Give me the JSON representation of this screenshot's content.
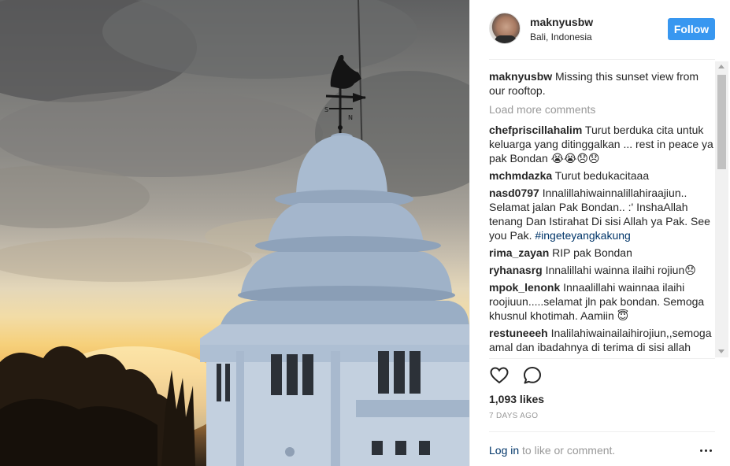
{
  "post": {
    "username": "maknyusbw",
    "location": "Bali, Indonesia",
    "follow_label": "Follow",
    "caption": "Missing this sunset view from our rooftop.",
    "load_more": "Load more comments"
  },
  "comments": [
    {
      "user": "chefpriscillahalim",
      "text": "Turut berduka cita untuk keluarga yang ditinggalkan ... rest in peace ya pak Bondan 😭😭😞😞"
    },
    {
      "user": "mchmdazka",
      "text": "Turut bedukacitaaa"
    },
    {
      "user": "nasd0797",
      "text": "Innalillahiwainnalillahiraajiun.. Selamat jalan Pak Bondan.. :' InshaAllah tenang Dan Istirahat Di sisi Allah ya Pak. See you Pak.",
      "hashtag": "#ingeteyangkakung"
    },
    {
      "user": "rima_zayan",
      "text": "RIP pak Bondan"
    },
    {
      "user": "ryhanasrg",
      "text": "Innalillahi wainna ilaihi rojiun😞"
    },
    {
      "user": "mpok_lenonk",
      "text": "Innaalillahi wainnaa ilaihi roojiuun.....selamat jln pak bondan. Semoga khusnul khotimah. Aamiin 😇"
    },
    {
      "user": "restuneeeh",
      "text": "Inalilahiwainailaihirojiun,,semoga amal dan ibadahnya di terima di sisi allah"
    }
  ],
  "stats": {
    "likes": "1,093 likes",
    "timestamp": "7 DAYS AGO"
  },
  "footer": {
    "login_link": "Log in",
    "login_rest": " to like or comment."
  },
  "icons": {
    "like": "heart-icon",
    "comment": "comment-bubble-icon",
    "more": "more-options-icon"
  },
  "colors": {
    "follow_button": "#3897f0",
    "link": "#003569",
    "muted": "#999999"
  }
}
